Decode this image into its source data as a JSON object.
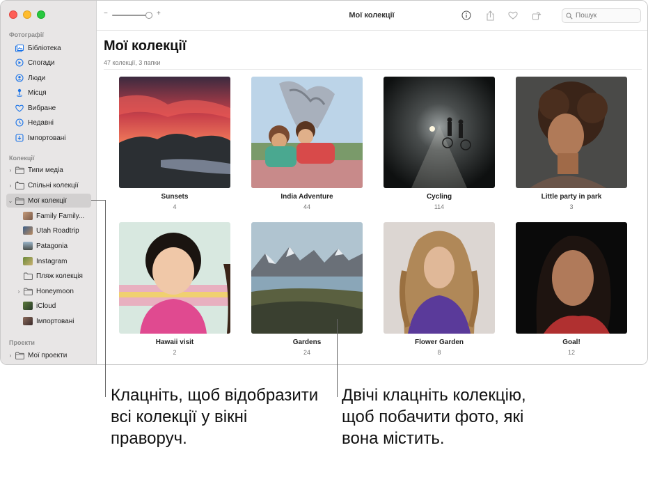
{
  "window": {
    "title": "Мої колекції"
  },
  "search": {
    "placeholder": "Пошук"
  },
  "sidebar": {
    "section_photos": "Фотографії",
    "photos_items": [
      {
        "label": "Бібліотека",
        "icon": "library-icon"
      },
      {
        "label": "Спогади",
        "icon": "memories-icon"
      },
      {
        "label": "Люди",
        "icon": "people-icon"
      },
      {
        "label": "Місця",
        "icon": "places-icon"
      },
      {
        "label": "Вибране",
        "icon": "heart-icon"
      },
      {
        "label": "Недавні",
        "icon": "clock-icon"
      },
      {
        "label": "Імпортовані",
        "icon": "import-icon"
      }
    ],
    "section_collections": "Колекції",
    "collection_items": [
      {
        "label": "Типи медіа",
        "icon": "folder-icon"
      },
      {
        "label": "Спільні колекції",
        "icon": "shared-folder-icon"
      },
      {
        "label": "Мої колекції",
        "icon": "folder-icon"
      }
    ],
    "my_collections": [
      {
        "label": "Family Family..."
      },
      {
        "label": "Utah Roadtrip"
      },
      {
        "label": "Patagonia"
      },
      {
        "label": "Instagram"
      },
      {
        "label": "Пляж колекція"
      },
      {
        "label": "Honeymoon"
      },
      {
        "label": "iCloud"
      },
      {
        "label": "Імпортовані"
      }
    ],
    "section_projects": "Проекти",
    "project_items": [
      {
        "label": "Мої проекти",
        "icon": "folder-icon"
      }
    ]
  },
  "content": {
    "title": "Мої колекції",
    "subtitle": "47 колекції, 3 папки",
    "albums": [
      {
        "name": "Sunsets",
        "count": "4"
      },
      {
        "name": "India Adventure",
        "count": "44"
      },
      {
        "name": "Cycling",
        "count": "114"
      },
      {
        "name": "Little party in park",
        "count": "3"
      },
      {
        "name": "Hawaii visit",
        "count": "2"
      },
      {
        "name": "Gardens",
        "count": "24"
      },
      {
        "name": "Flower Garden",
        "count": "8"
      },
      {
        "name": "Goal!",
        "count": "12"
      }
    ]
  },
  "callouts": {
    "left": "Клацніть, щоб відобразити всі колекції у вікні праворуч.",
    "right": "Двічі клацніть колекцію, щоб побачити фото, які вона містить."
  },
  "colors": {
    "sidebar_bg": "#e8e6e6",
    "accent": "#1a73e8",
    "selected_bg": "#d2d0d0"
  }
}
